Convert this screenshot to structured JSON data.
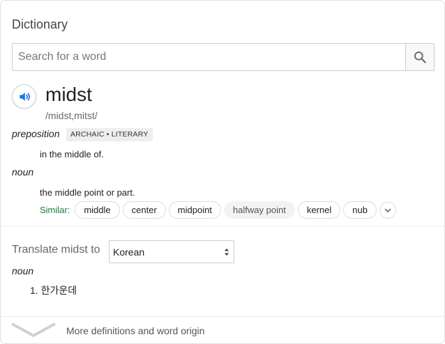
{
  "panel": {
    "title": "Dictionary",
    "search": {
      "placeholder": "Search for a word",
      "value": ""
    },
    "icons": {
      "search": "search-icon",
      "speaker": "speaker-icon",
      "expand": "chevron-down-icon",
      "more": "chevron-down-icon"
    }
  },
  "entry": {
    "word": "midst",
    "pronunciation": "/midst,mitst/",
    "senses": [
      {
        "pos": "preposition",
        "label": "ARCHAIC • LITERARY",
        "definition": "in the middle of."
      },
      {
        "pos": "noun",
        "definition": "the middle point or part."
      }
    ],
    "similar": {
      "label": "Similar:",
      "words": [
        "middle",
        "center",
        "midpoint",
        "halfway point",
        "kernel",
        "nub"
      ]
    }
  },
  "translate": {
    "label": "Translate midst to",
    "selected_language": "Korean",
    "pos": "noun",
    "results": [
      "1. 한가운데"
    ]
  },
  "footer": {
    "more_label": "More definitions and word origin"
  },
  "colors": {
    "accent_blue": "#1a73e8",
    "similar_green": "#188038"
  }
}
